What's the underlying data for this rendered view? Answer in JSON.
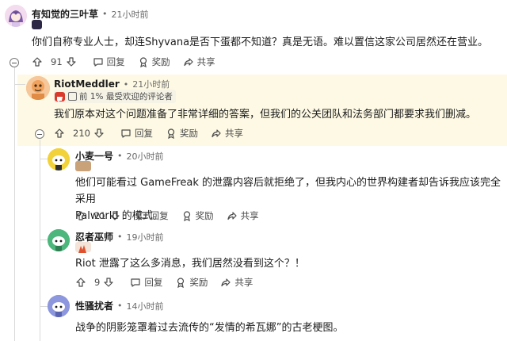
{
  "comments": [
    {
      "author": "有知觉的三叶草",
      "time": "21小时前",
      "body": "你们自称专业人士，却连Shyvana是否下蛋都不知道？真是无语。难以置信这家公司居然还在营业。",
      "votes": "91",
      "reply": "回复",
      "award": "奖励",
      "share": "共享"
    },
    {
      "author": "RiotMeddler",
      "time": "21小时前",
      "flair": "前 1% 最受欢迎的评论者",
      "body": "我们原本对这个问题准备了非常详细的答案，但我们的公关团队和法务部门都要求我们删减。",
      "votes": "210",
      "reply": "回复",
      "award": "奖励",
      "share": "共享"
    },
    {
      "author": "小麦一号",
      "time": "20小时前",
      "body_line1": "他们可能看过 GameFreak 的泄露内容后就拒绝了，但我内心的世界构建者却告诉我应该完全采用",
      "body_line2": "Palworld 的模式。",
      "votes": "21",
      "reply": "回复",
      "award": "奖励",
      "share": "共享"
    },
    {
      "author": "忍者巫师",
      "time": "19小时前",
      "body": "Riot 泄露了这么多消息，我们居然没看到这个？！",
      "votes": "9",
      "reply": "回复",
      "award": "奖励",
      "share": "共享"
    },
    {
      "author": "性骚扰者",
      "time": "14小时前",
      "body": "战争的阴影笼罩着过去流传的“发情的希瓦娜”的古老梗图。"
    }
  ],
  "separator": "•",
  "colors": {
    "highlight": "#fdf9e4",
    "flair_red": "#d93a2b"
  }
}
